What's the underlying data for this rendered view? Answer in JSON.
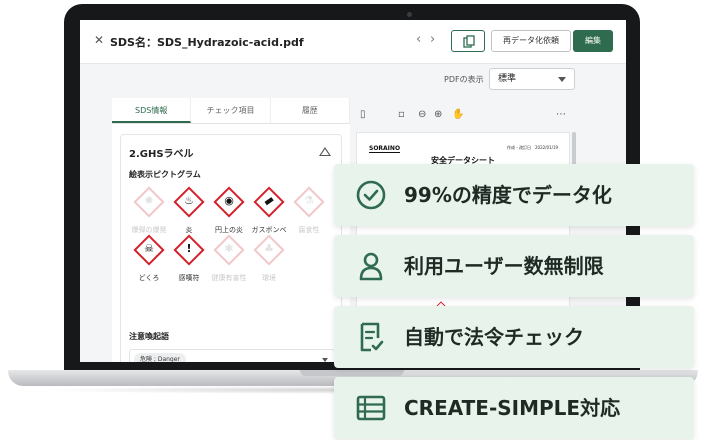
{
  "window": {
    "title": "SDS名：SDS_Hydrazoic-acid.pdf",
    "close_icon": "close-icon",
    "reconvert_label": "再データ化依頼",
    "edit_label": "編集"
  },
  "pdf_view": {
    "label": "PDFの表示",
    "selected": "標準"
  },
  "tabs": [
    {
      "label": "SDS情報",
      "active": true
    },
    {
      "label": "チェック項目",
      "active": false
    },
    {
      "label": "履歴",
      "active": false
    }
  ],
  "ghs": {
    "section_title": "2.GHSラベル",
    "pictogram_heading": "絵表示ピクトグラム",
    "pictograms": [
      {
        "label": "爆弾の爆発",
        "icon": "exploding-bomb-icon",
        "active": false
      },
      {
        "label": "炎",
        "icon": "flame-icon",
        "active": true
      },
      {
        "label": "円上の炎",
        "icon": "flame-over-circle-icon",
        "active": true
      },
      {
        "label": "ガスボンベ",
        "icon": "gas-cylinder-icon",
        "active": true
      },
      {
        "label": "腐食性",
        "icon": "corrosion-icon",
        "active": false
      },
      {
        "label": "どくろ",
        "icon": "skull-crossbones-icon",
        "active": true
      },
      {
        "label": "感嘆符",
        "icon": "exclamation-mark-icon",
        "active": true
      },
      {
        "label": "健康有害性",
        "icon": "health-hazard-icon",
        "active": false
      },
      {
        "label": "環境",
        "icon": "environment-icon",
        "active": false
      }
    ],
    "signal_heading": "注意喚起語",
    "signal_value": "危険 ; Danger"
  },
  "pdf_page": {
    "logo": "SORAINO",
    "meta": "作成・改訂日　2022/01/19",
    "doc_title": "安全データシート"
  },
  "features": [
    {
      "text": "99%の精度でデータ化",
      "icon": "check-circle-icon"
    },
    {
      "text": "利用ユーザー数無制限",
      "icon": "user-icon"
    },
    {
      "text": "自動で法令チェック",
      "icon": "document-check-icon"
    },
    {
      "text": "CREATE-SIMPLE対応",
      "icon": "table-list-icon"
    }
  ],
  "colors": {
    "brand_green": "#2f6b4f",
    "feature_bg": "#e8f3ec",
    "ghs_red": "#d4202a"
  }
}
